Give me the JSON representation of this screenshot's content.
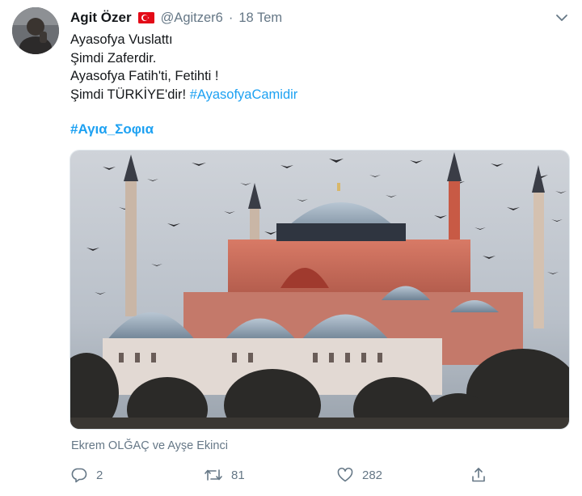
{
  "tweet": {
    "author_name": "Agit Özer",
    "author_flag": "turkey-flag-icon",
    "handle": "@Agitzer6",
    "separator": "·",
    "date": "18 Tem",
    "lines": [
      "Ayasofya  Vuslattı",
      "Şimdi Zaferdir.",
      "Ayasofya Fatih'ti, Fetihti !",
      "Şimdi TÜRKİYE'dir! "
    ],
    "hashtag_inline": "#AyasofyaCamidir",
    "hashtag_greek": "#Αγια_Σοφια",
    "tagged": "Ekrem OLĞAÇ ve Ayşe Ekinci",
    "actions": {
      "reply_count": "2",
      "retweet_count": "81",
      "like_count": "282"
    }
  },
  "colors": {
    "link": "#1da1f2",
    "secondary_text": "#657786",
    "flag_red": "#e30a17"
  },
  "icons": [
    "chevron-down-icon",
    "reply-icon",
    "retweet-icon",
    "like-icon",
    "share-icon"
  ]
}
